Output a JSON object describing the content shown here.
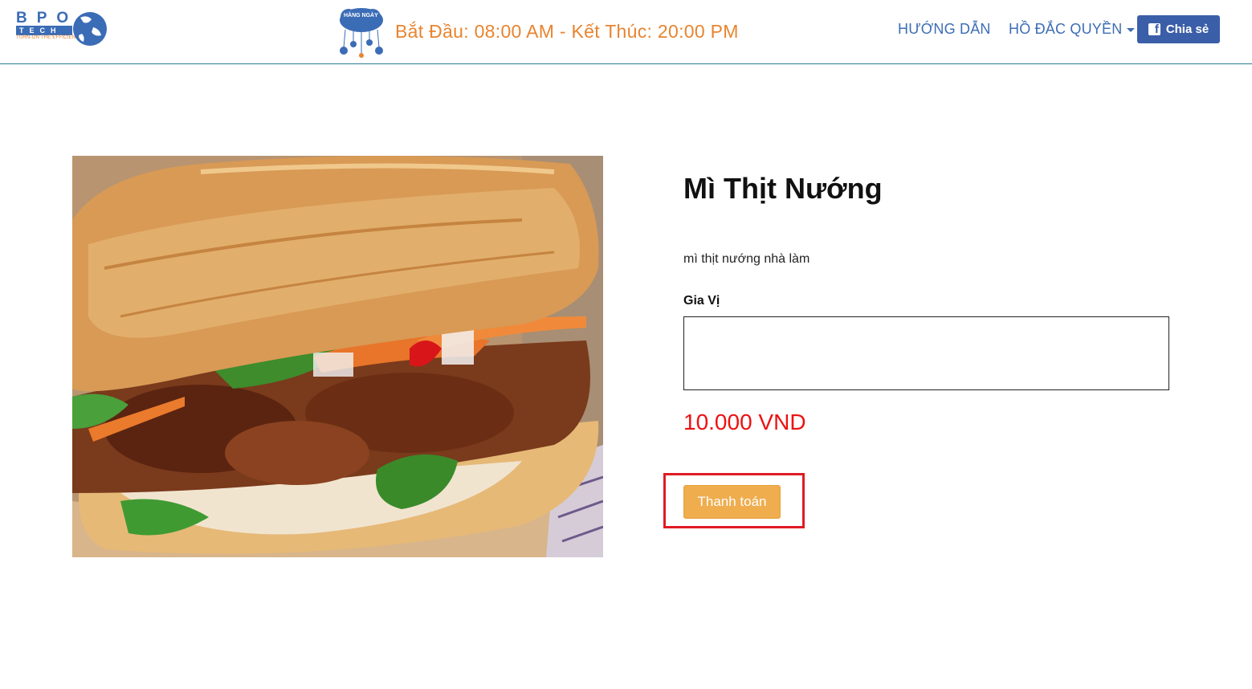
{
  "header": {
    "logo": {
      "line1": "BPO",
      "line2": "TECH",
      "tagline": "TURN-ON THE EFFICIENCY"
    },
    "daily_badge": "HẰNG NGÀY",
    "hours_text": "Bắt Đầu: 08:00 AM - Kết Thúc: 20:00 PM",
    "nav": {
      "guide_label": "HƯỚNG DẪN",
      "user_label": "HỒ ĐẮC QUYỀN",
      "share_label": "Chia sẻ"
    }
  },
  "product": {
    "title": "Mì Thịt Nướng",
    "description": "mì thịt nướng nhà làm",
    "spice_label": "Gia Vị",
    "spice_value": "",
    "price": "10.000 VND",
    "pay_label": "Thanh toán"
  },
  "icons": [
    "globe-icon",
    "cloud-icon",
    "caret-down-icon",
    "facebook-icon"
  ],
  "colors": {
    "accent_orange": "#e8842f",
    "nav_blue": "#3d6db5",
    "share_blue": "#3b5ea8",
    "price_red": "#ee1111",
    "pay_button": "#efad4e",
    "highlight_red": "#e01b24"
  }
}
